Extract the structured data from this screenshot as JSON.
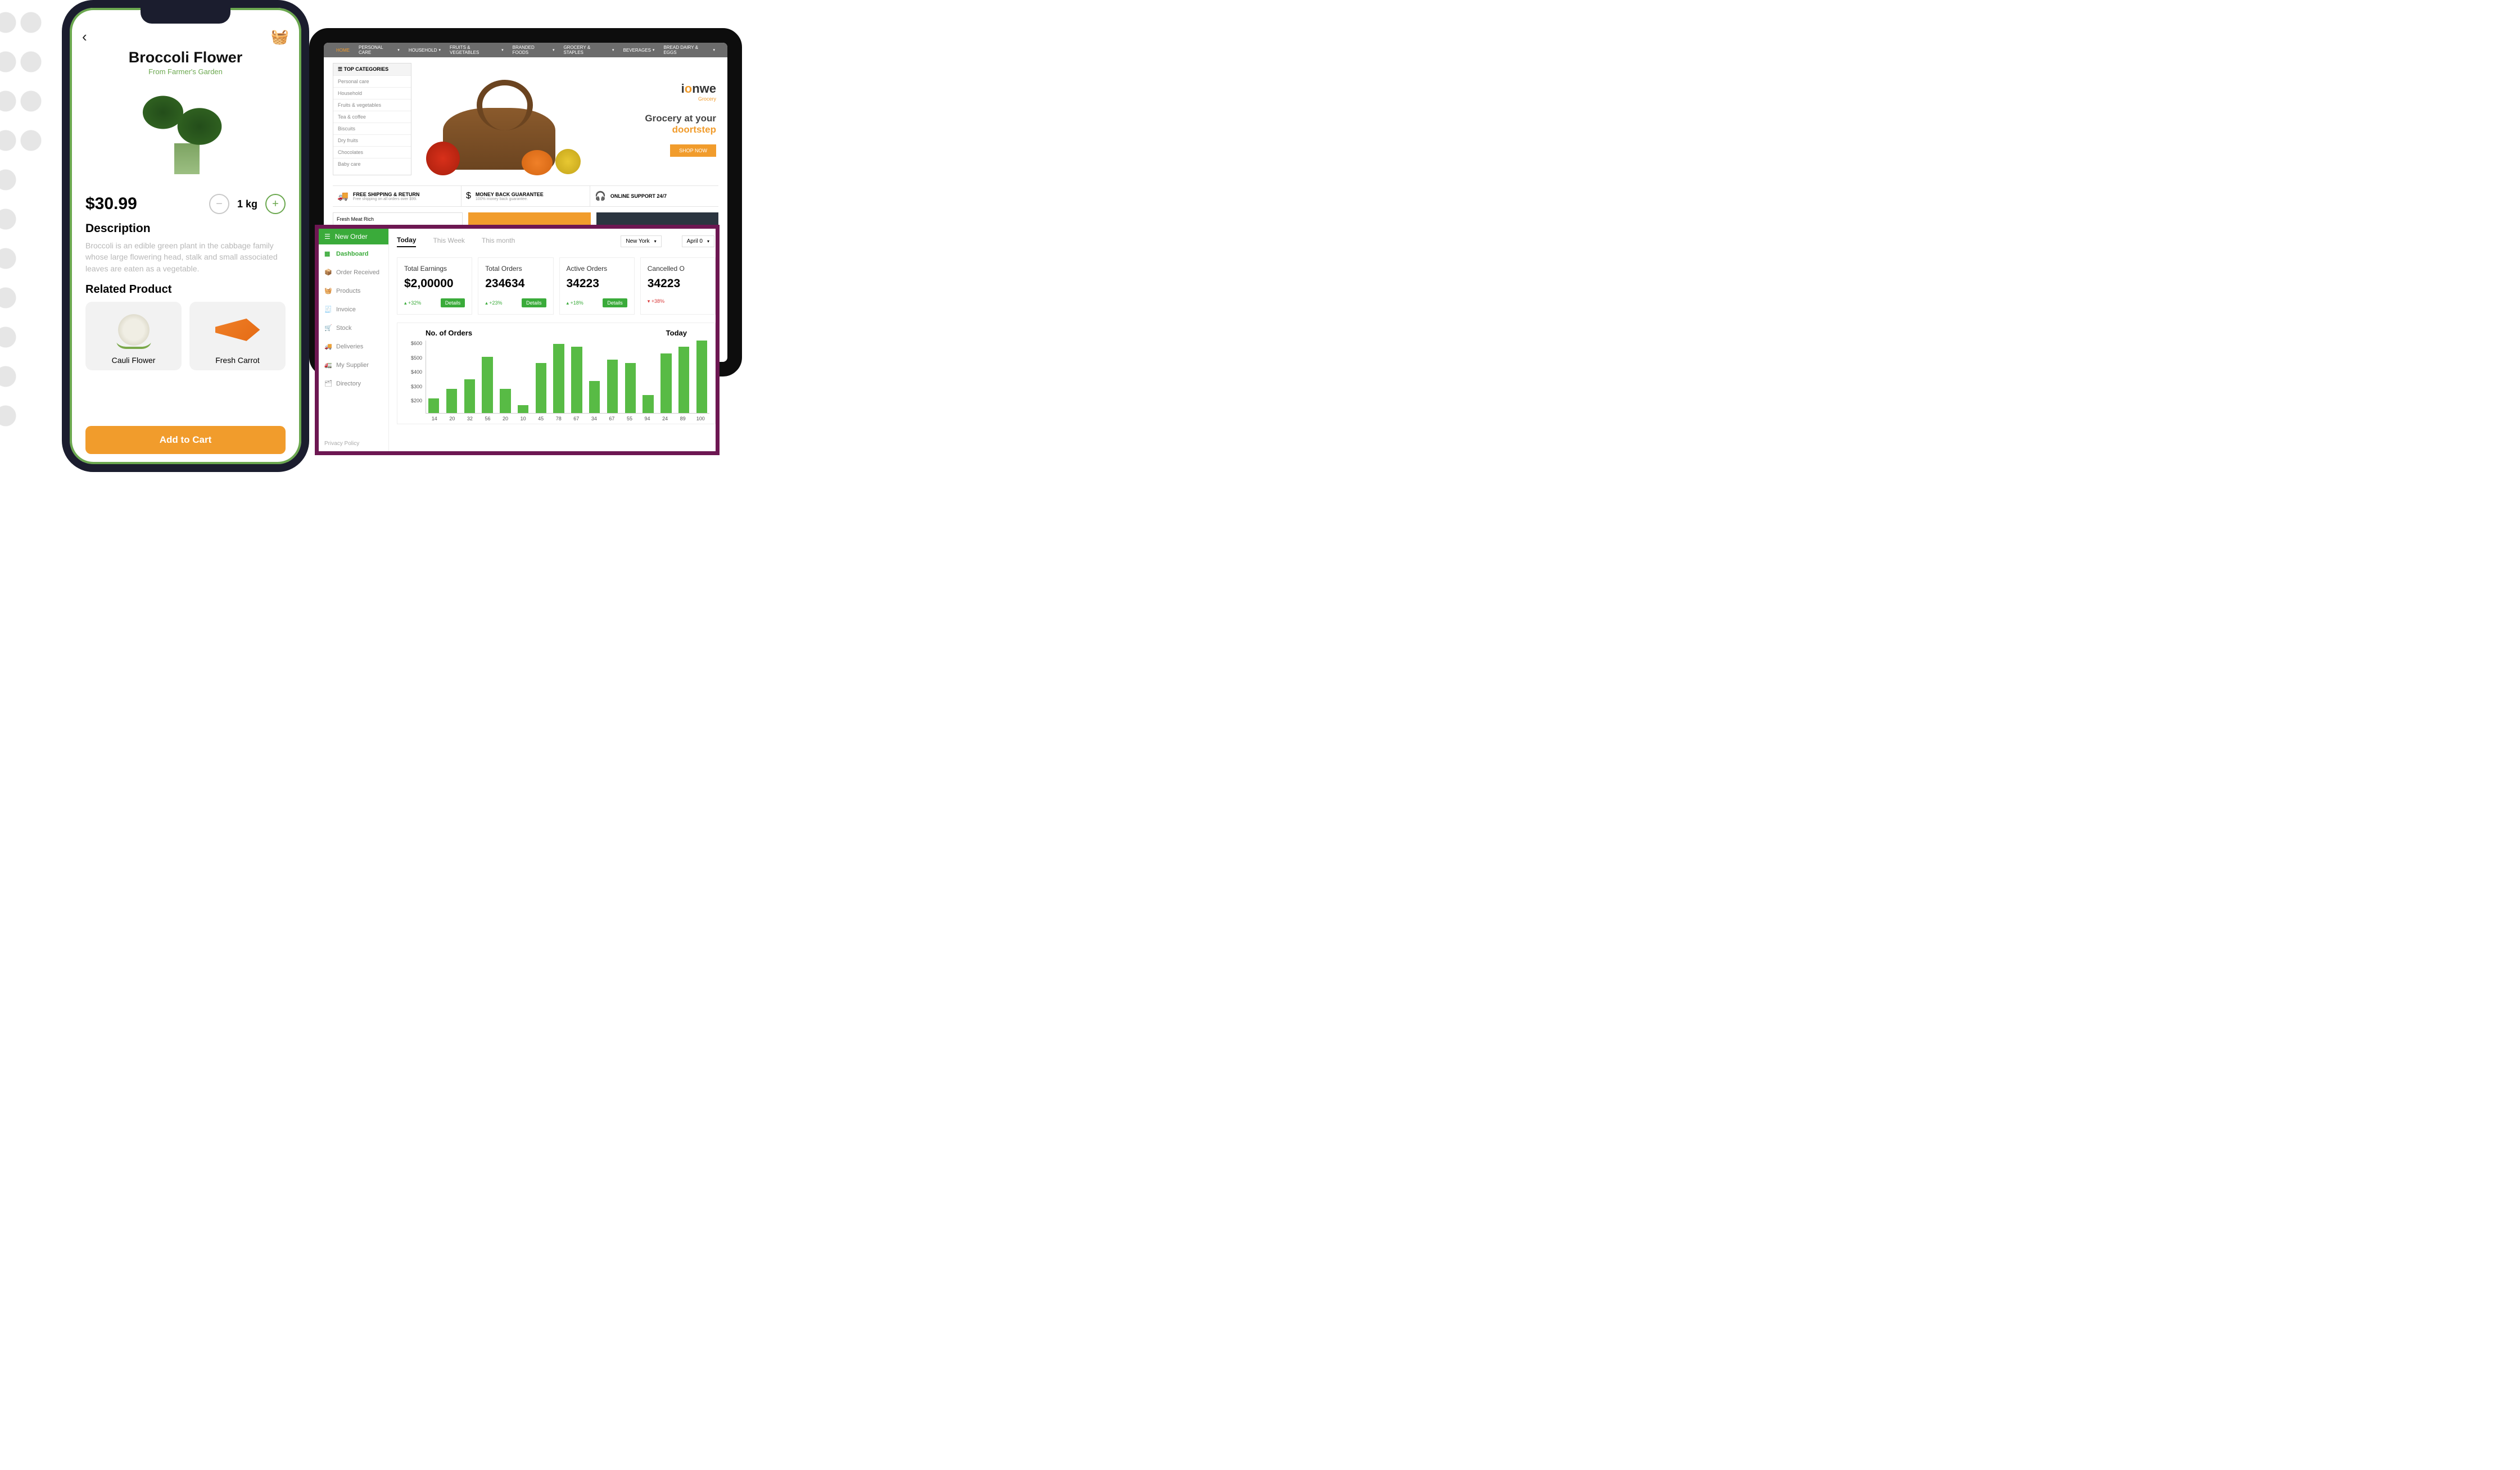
{
  "phone": {
    "title": "Broccoli Flower",
    "subtitle": "From Farmer's Garden",
    "price": "$30.99",
    "quantity": "1 kg",
    "desc_heading": "Description",
    "description": "Broccoli is an edible green plant in the cabbage family whose large flowering head, stalk and small associated leaves are eaten as a vegetable.",
    "related_heading": "Related Product",
    "related": [
      {
        "name": "Cauli Flower"
      },
      {
        "name": "Fresh Carrot"
      }
    ],
    "add_to_cart": "Add to Cart"
  },
  "tablet": {
    "nav": [
      "HOME",
      "PERSONAL CARE",
      "HOUSEHOLD",
      "FRUITS & VEGETABLES",
      "BRANDED FOODS",
      "GROCERY & STAPLES",
      "BEVERAGES",
      "BREAD DAIRY & EGGS"
    ],
    "cat_heading": "☰ TOP CATEGORIES",
    "categories": [
      "Personal care",
      "Household",
      "Fruits & vegetables",
      "Tea & coffee",
      "Biscuits",
      "Dry fruits",
      "Chocolates",
      "Baby care"
    ],
    "brand_a": "i",
    "brand_b": "o",
    "brand_c": "nwe",
    "brand_sub": "Grocery",
    "tagline1": "Grocery at your",
    "tagline2": "doortstep",
    "shop_now": "SHOP NOW",
    "trust": [
      {
        "icon": "🚚",
        "t1": "FREE SHIPPING & RETURN",
        "t2": "Free shipping on all orders over $99."
      },
      {
        "icon": "$",
        "t1": "MONEY BACK GUARANTEE",
        "t2": "100% money back guarantee."
      },
      {
        "icon": "🎧",
        "t1": "ONLINE SUPPORT 24/7",
        "t2": ""
      }
    ],
    "banner_label": "Fresh Meat Rich"
  },
  "dashboard": {
    "new_order": "New Order",
    "menu": [
      {
        "icon": "▦",
        "label": "Dashboard",
        "active": true
      },
      {
        "icon": "📦",
        "label": "Order Received"
      },
      {
        "icon": "🧺",
        "label": "Products"
      },
      {
        "icon": "🧾",
        "label": "Invoice"
      },
      {
        "icon": "🛒",
        "label": "Stock"
      },
      {
        "icon": "🚚",
        "label": "Deliveries"
      },
      {
        "icon": "🚛",
        "label": "My Supplier"
      },
      {
        "icon": "🗂",
        "label": "Directory"
      }
    ],
    "privacy": "Privacy Policy",
    "tabs": [
      "Today",
      "This Week",
      "This month"
    ],
    "location": "New York",
    "date": "April 0",
    "kpis": [
      {
        "title": "Total Earnings",
        "value": "$2,00000",
        "delta": "▴ +32%",
        "dir": "up",
        "btn": "Details"
      },
      {
        "title": "Total Orders",
        "value": "234634",
        "delta": "▴ +23%",
        "dir": "up",
        "btn": "Details"
      },
      {
        "title": "Active Orders",
        "value": "34223",
        "delta": "▴ +18%",
        "dir": "up",
        "btn": "Details"
      },
      {
        "title": "Cancelled O",
        "value": "34223",
        "delta": "▾ +38%",
        "dir": "down",
        "btn": ""
      }
    ],
    "chart_title": "No. of Orders",
    "chart_period": "Today"
  },
  "chart_data": {
    "type": "bar",
    "title": "No. of Orders",
    "ylabel": "",
    "xlabel": "",
    "ylim": [
      150,
      600
    ],
    "yticks": [
      600,
      500,
      400,
      300,
      200
    ],
    "categories": [
      14,
      20,
      32,
      56,
      20,
      10,
      45,
      78,
      67,
      34,
      67,
      55,
      94,
      24,
      89,
      100
    ],
    "values": [
      240,
      300,
      360,
      500,
      300,
      200,
      460,
      580,
      560,
      350,
      480,
      460,
      260,
      520,
      560,
      600
    ]
  }
}
